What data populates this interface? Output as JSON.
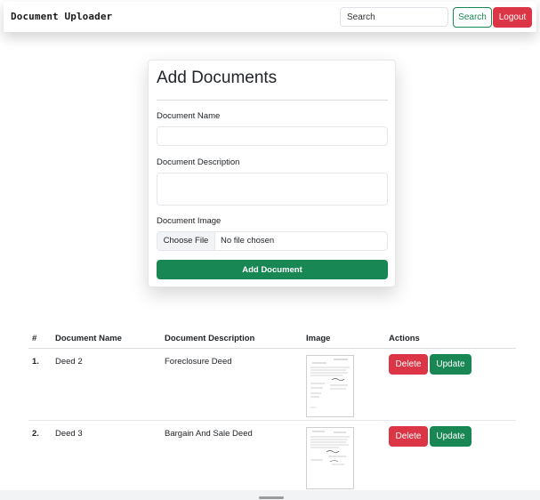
{
  "navbar": {
    "brand": "Document Uploader",
    "search_placeholder": "Search",
    "search_label": "Search",
    "logout_label": "Logout"
  },
  "form": {
    "title": "Add Documents",
    "name_label": "Document Name",
    "description_label": "Document Description",
    "image_label": "Document Image",
    "choose_file_label": "Choose File",
    "file_status": "No file chosen",
    "submit_label": "Add Document"
  },
  "table": {
    "headers": [
      "#",
      "Document Name",
      "Document Description",
      "Image",
      "Actions"
    ],
    "rows": [
      {
        "num": "1.",
        "name": "Deed 2",
        "description": "Foreclosure Deed",
        "delete_label": "Delete",
        "update_label": "Update"
      },
      {
        "num": "2.",
        "name": "Deed 3",
        "description": "Bargain And Sale Deed",
        "delete_label": "Delete",
        "update_label": "Update"
      }
    ]
  },
  "colors": {
    "success": "#198754",
    "danger": "#dc3545",
    "text": "#212529"
  }
}
